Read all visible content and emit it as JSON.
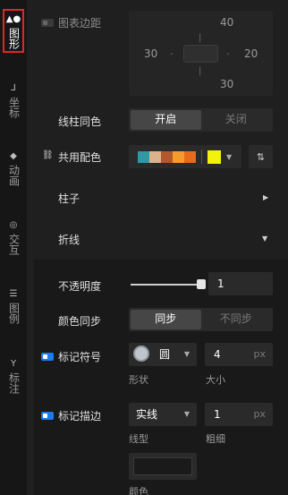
{
  "sidebar": {
    "items": [
      {
        "label": "图形",
        "icon": "shapes-icon",
        "active": true
      },
      {
        "label": "坐标",
        "icon": "axis-icon"
      },
      {
        "label": "动画",
        "icon": "animation-icon"
      },
      {
        "label": "交互",
        "icon": "interaction-icon"
      },
      {
        "label": "图例",
        "icon": "legend-icon"
      },
      {
        "label": "标注",
        "icon": "annotation-icon"
      }
    ]
  },
  "chart_margin": {
    "label": "图表边距",
    "top": "40",
    "left": "30",
    "right": "20",
    "bottom": "30"
  },
  "bar_color": {
    "label": "线柱同色",
    "on": "开启",
    "off": "关闭",
    "selected": "开启"
  },
  "palette": {
    "label": "共用配色",
    "swatches": [
      "#2e9aa7",
      "#d9b38c",
      "#b3572d",
      "#f39c2b",
      "#e86a1a"
    ],
    "accent": "#f2f20a"
  },
  "sections": {
    "bar": "柱子",
    "line": "折线"
  },
  "opacity": {
    "label": "不透明度",
    "value": "1",
    "level": 1
  },
  "color_sync": {
    "label": "颜色同步",
    "on": "同步",
    "off": "不同步",
    "selected": "同步"
  },
  "marker_symbol": {
    "label": "标记符号",
    "shape_value": "圆",
    "shape_label": "形状",
    "size_value": "4",
    "size_unit": "px",
    "size_label": "大小"
  },
  "marker_stroke": {
    "label": "标记描边",
    "type_value": "实线",
    "type_label": "线型",
    "width_value": "1",
    "width_unit": "px",
    "width_label": "粗细",
    "color_label": "颜色"
  }
}
